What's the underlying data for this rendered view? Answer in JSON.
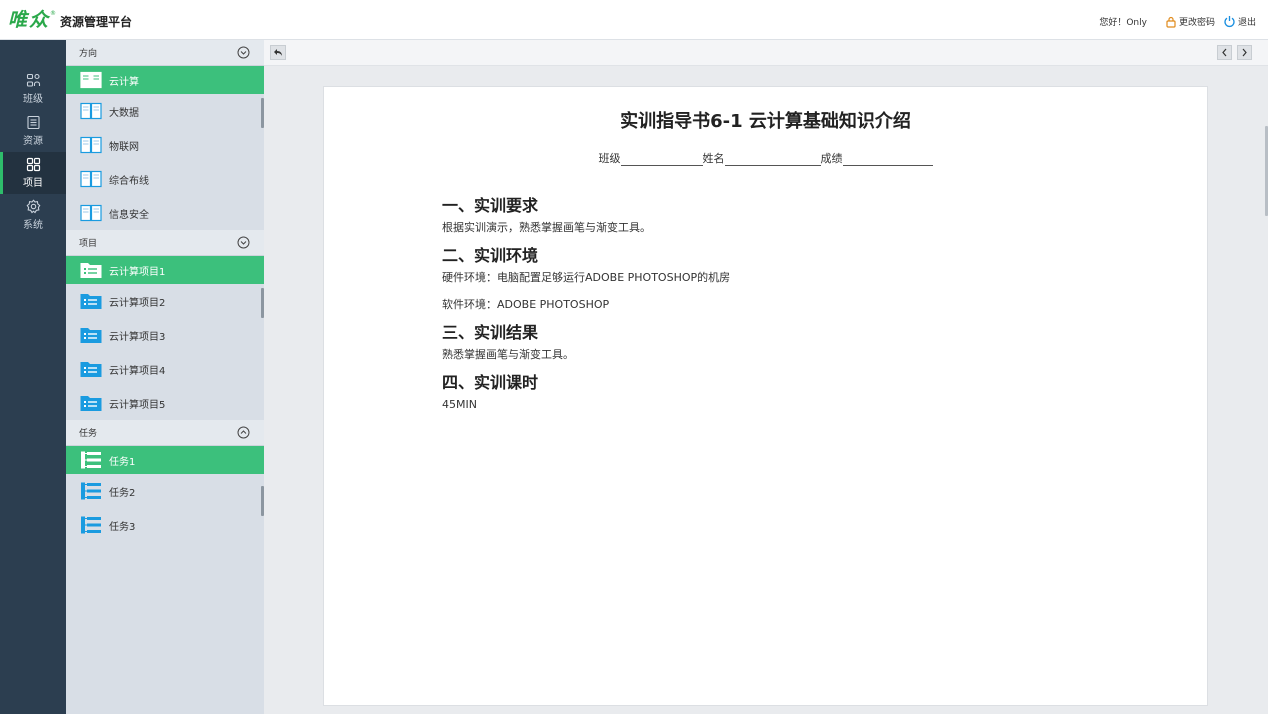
{
  "header": {
    "brand": "唯众",
    "reg_mark": "®",
    "platform_name": "资源管理平台",
    "greeting": "您好！Only",
    "change_password": "更改密码",
    "logout": "退出"
  },
  "iconnav": {
    "items": [
      {
        "label": "班级",
        "icon": "class-icon"
      },
      {
        "label": "资源",
        "icon": "resource-icon"
      },
      {
        "label": "项目",
        "icon": "project-icon",
        "active": true
      },
      {
        "label": "系统",
        "icon": "system-icon"
      }
    ]
  },
  "sidebar": {
    "direction": {
      "title": "方向",
      "items": [
        "云计算",
        "大数据",
        "物联网",
        "综合布线",
        "信息安全"
      ],
      "active_index": 0
    },
    "project": {
      "title": "项目",
      "items": [
        "云计算项目1",
        "云计算项目2",
        "云计算项目3",
        "云计算项目4",
        "云计算项目5"
      ],
      "active_index": 0
    },
    "task": {
      "title": "任务",
      "items": [
        "任务1",
        "任务2",
        "任务3"
      ],
      "active_index": 0
    }
  },
  "document": {
    "title": "实训指导书6-1 云计算基础知识介绍",
    "field_class": "班级",
    "field_name": "姓名",
    "field_score": "成绩",
    "sections": [
      {
        "heading": "一、实训要求",
        "paragraphs": [
          "根据实训演示，熟悉掌握画笔与渐变工具。"
        ]
      },
      {
        "heading": "二、实训环境",
        "paragraphs": [
          "硬件环境：电脑配置足够运行ADOBE PHOTOSHOP的机房",
          "软件环境：ADOBE PHOTOSHOP"
        ]
      },
      {
        "heading": "三、实训结果",
        "paragraphs": [
          "熟悉掌握画笔与渐变工具。"
        ]
      },
      {
        "heading": "四、实训课时",
        "paragraphs": [
          "45MIN"
        ]
      }
    ]
  },
  "colors": {
    "accent_green": "#3cc07c",
    "nav_dark": "#2c3e50",
    "sidebar_bg": "#d8dee6",
    "icon_blue": "#1a9be0"
  }
}
